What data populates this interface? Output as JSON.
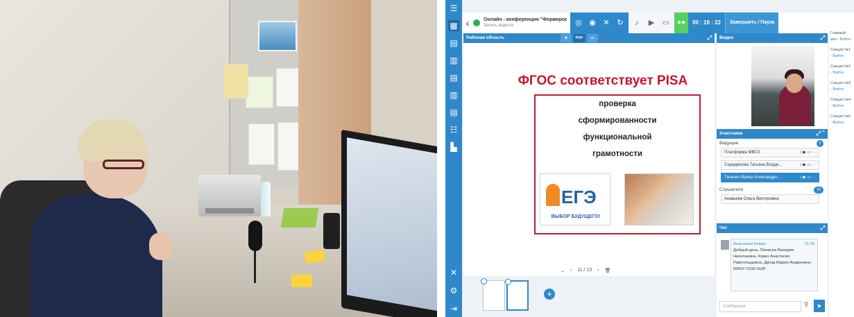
{
  "app": {
    "back_icon": "‹",
    "conference_title": "Онлайн - конференция \"Формирование функциональной...",
    "recording_status": "Запись ведется",
    "timer": "00 : 18 : 22",
    "finish_label": "Завершить / Пауза"
  },
  "work_panel": {
    "title": "Рабочая область",
    "tab_pdf": "PDF",
    "pager_prev": "‹",
    "pager_text": "11 / 13",
    "pager_next": "›"
  },
  "slide": {
    "title": "ФГОС соответствует PISA",
    "lines": [
      "проверка",
      "сформированности",
      "функциональной",
      "грамотности"
    ],
    "ege_word": "ЕГЭ",
    "ege_sub": "ВЫБОР БУДУЩЕГО!"
  },
  "video_panel": {
    "title": "Видео"
  },
  "participants": {
    "title": "Участники",
    "hosts_label": "Ведущие",
    "hosts_count": "3",
    "hosts": [
      "Платформа МВСS",
      "Сераджнова Татьяна Влади...",
      "Тальчко Ирина Александро..."
    ],
    "listeners_label": "Слушатели",
    "listeners_count": "76",
    "listeners": [
      "Анакьева Ольга Викторовна"
    ]
  },
  "chat": {
    "title": "Чат",
    "author": "Анастасия Коваи",
    "time": "11:16",
    "message": "Добрый день. Панасюк Валерия Николаевна, Ковач Анастасия Райнгольдовна, Дрозд Мария Андреевна - МАОУ СОШ №36",
    "input_placeholder": "Сообщение"
  },
  "sections": [
    {
      "label": "Главный зал",
      "link": "Войти"
    },
    {
      "label": "Секция №1",
      "link": "Войти"
    },
    {
      "label": "Секция №2",
      "link": "Войти"
    },
    {
      "label": "Секция №3",
      "link": "Войти"
    },
    {
      "label": "Секция №4",
      "link": "Войти"
    },
    {
      "label": "Секция №5",
      "link": "Войти"
    }
  ],
  "colors": {
    "accent": "#2f88c9",
    "live": "#2bb34a",
    "slide_red": "#c1182d"
  }
}
